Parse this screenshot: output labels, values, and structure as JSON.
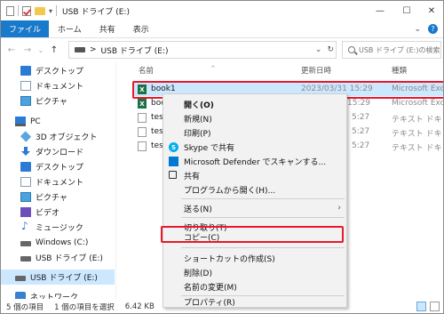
{
  "window": {
    "title": "USB ドライブ (E:)",
    "minimize": "—",
    "maximize": "☐",
    "close": "✕"
  },
  "ribbon": {
    "tabs": [
      "ファイル",
      "ホーム",
      "共有",
      "表示"
    ],
    "expand": "⌄",
    "help": "?"
  },
  "nav": {
    "back": "←",
    "forward": "→",
    "recent": "⌄",
    "up": "↑",
    "address_sep": ">",
    "address": "USB ドライブ (E:)",
    "address_dropdown": "⌄",
    "refresh": "↻",
    "search_placeholder": "USB ドライブ (E:)の検索"
  },
  "sidebar": {
    "items": [
      {
        "label": "デスクトップ",
        "icon": "desktop-icon"
      },
      {
        "label": "ドキュメント",
        "icon": "documents-icon"
      },
      {
        "label": "ピクチャ",
        "icon": "pictures-icon"
      },
      {
        "label": "PC",
        "icon": "pc-icon"
      },
      {
        "label": "3D オブジェクト",
        "icon": "3d-objects-icon"
      },
      {
        "label": "ダウンロード",
        "icon": "download-icon"
      },
      {
        "label": "デスクトップ",
        "icon": "desktop-icon"
      },
      {
        "label": "ドキュメント",
        "icon": "documents-icon"
      },
      {
        "label": "ピクチャ",
        "icon": "pictures-icon"
      },
      {
        "label": "ビデオ",
        "icon": "video-icon"
      },
      {
        "label": "ミュージック",
        "icon": "music-icon"
      },
      {
        "label": "Windows (C:)",
        "icon": "drive-icon"
      },
      {
        "label": "USB ドライブ (E:)",
        "icon": "drive-icon"
      },
      {
        "label": "USB ドライブ (E:)",
        "icon": "drive-icon"
      },
      {
        "label": "ネットワーク",
        "icon": "network-icon"
      }
    ]
  },
  "columns": {
    "name": "名前",
    "modified": "更新日時",
    "type": "種類"
  },
  "files": [
    {
      "name": "book1",
      "modified": "2023/03/31 15:29",
      "type": "Microsoft Excel",
      "icon": "excel-icon"
    },
    {
      "name": "boo",
      "modified": "15:29",
      "type": "Microsoft Excel",
      "icon": "excel-icon"
    },
    {
      "name": "test",
      "modified": "5:27",
      "type": "テキスト ドキュメ",
      "icon": "text-file-icon"
    },
    {
      "name": "test",
      "modified": "5:27",
      "type": "テキスト ドキュメ",
      "icon": "text-file-icon"
    },
    {
      "name": "test",
      "modified": "5:27",
      "type": "テキスト ドキュメ",
      "icon": "text-file-icon"
    }
  ],
  "context_menu": {
    "items": [
      "開く(O)",
      "新規(N)",
      "印刷(P)",
      "Skype で共有",
      "Microsoft Defender でスキャンする...",
      "共有",
      "プログラムから開く(H)...",
      "送る(N)",
      "切り取り(T)",
      "コピー(C)",
      "ショートカットの作成(S)",
      "削除(D)",
      "名前の変更(M)",
      "プロパティ(R)"
    ],
    "submenu_arrow": "›",
    "skype_letter": "S"
  },
  "status": {
    "item_count": "5 個の項目",
    "selected": "1 個の項目を選択",
    "size": "6.42 KB"
  },
  "colors": {
    "accent": "#1979ca",
    "highlight": "#e8192c",
    "selection": "#cce8ff"
  }
}
